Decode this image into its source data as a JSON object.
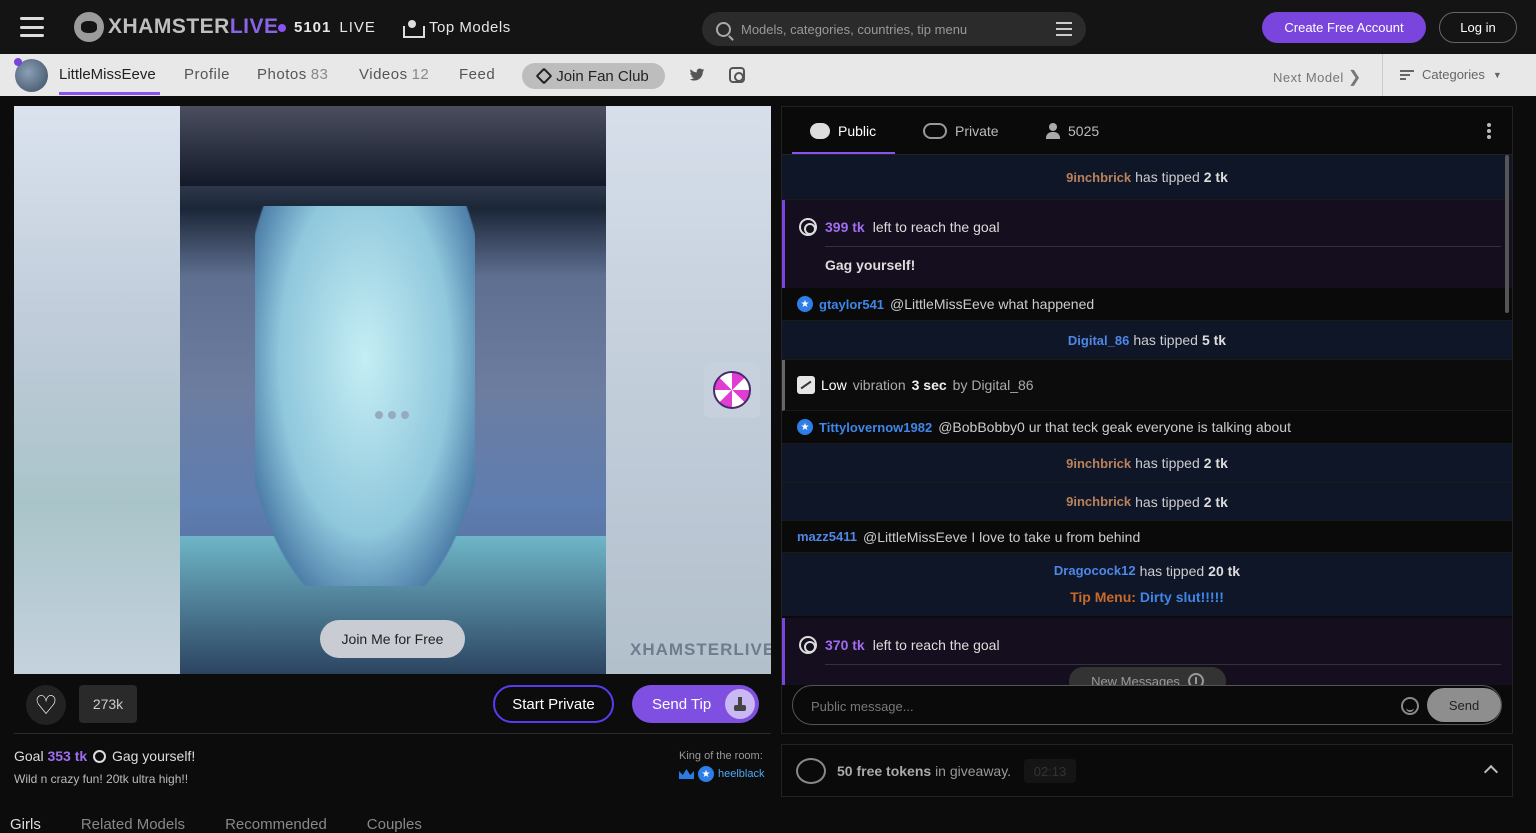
{
  "header": {
    "logo_part1": "XHAMSTER",
    "logo_part2": "LIVE",
    "live_count": "5101",
    "live_label": "LIVE",
    "top_models": "Top Models",
    "search_placeholder": "Models, categories, countries, tip menu",
    "create_account": "Create Free Account",
    "login": "Log in"
  },
  "model_bar": {
    "name": "LittleMissEeve",
    "nav": [
      {
        "label": "Profile",
        "count": ""
      },
      {
        "label": "Photos",
        "count": "83"
      },
      {
        "label": "Videos",
        "count": "12"
      },
      {
        "label": "Feed",
        "count": ""
      }
    ],
    "fan_club": "Join Fan Club",
    "next_model": "Next Model",
    "categories": "Categories"
  },
  "video": {
    "join_free": "Join Me for Free",
    "watermark": "XHAMSTERLIVE"
  },
  "actions": {
    "likes": "273k",
    "start_private": "Start Private",
    "send_tip": "Send Tip"
  },
  "goal": {
    "prefix": "Goal",
    "amount": "353 tk",
    "text": "Gag yourself!",
    "subtitle": "Wild n crazy fun! 20tk ultra high!!",
    "king_label": "King of the room:",
    "king_user": "heelblack"
  },
  "bottom_tabs": [
    "Girls",
    "Related Models",
    "Recommended",
    "Couples"
  ],
  "chat": {
    "tabs": {
      "public": "Public",
      "private": "Private",
      "viewers": "5025"
    },
    "messages": {
      "tip1": {
        "user": "9inchbrick",
        "text": "has tipped",
        "amount": "2 tk"
      },
      "goal1": {
        "amount": "399 tk",
        "text": "left to reach the goal",
        "goal": "Gag yourself!"
      },
      "msg1": {
        "user": "gtaylor541",
        "text": "@LittleMissEeve what happened"
      },
      "tip2": {
        "user": "Digital_86",
        "text": "has tipped",
        "amount": "5 tk"
      },
      "vib": {
        "level": "Low",
        "word": "vibration",
        "duration": "3 sec",
        "by": "by Digital_86"
      },
      "msg2": {
        "user": "Tittylovernow1982",
        "text": "@BobBobby0 ur that teck geak everyone is talking about"
      },
      "tip3": {
        "user": "9inchbrick",
        "text": "has tipped",
        "amount": "2 tk"
      },
      "tip4": {
        "user": "9inchbrick",
        "text": "has tipped",
        "amount": "2 tk"
      },
      "msg3": {
        "user": "mazz5411",
        "text": "@LittleMissEeve I love to take u from behind"
      },
      "tip5": {
        "user": "Dragocock12",
        "text": "has tipped",
        "amount": "20 tk",
        "menu_label": "Tip Menu:",
        "menu_item": "Dirty slut!!!!!"
      },
      "goal2": {
        "amount": "370 tk",
        "text": "left to reach the goal"
      }
    },
    "new_messages": "New Messages",
    "input_placeholder": "Public message...",
    "send": "Send"
  },
  "giveaway": {
    "tokens": "50 free tokens",
    "text": "in giveaway.",
    "timer": "02:13"
  }
}
